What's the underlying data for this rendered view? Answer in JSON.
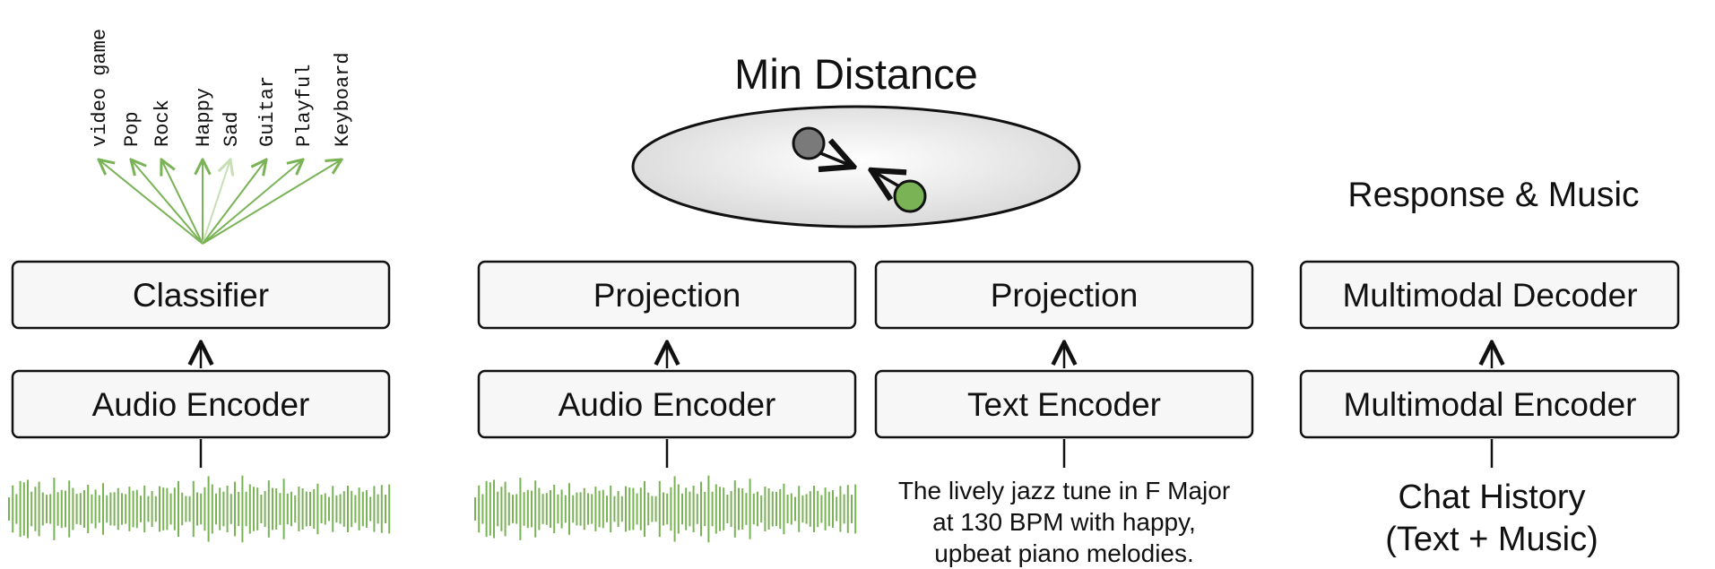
{
  "classification": {
    "labels": [
      "video game",
      "Pop",
      "Rock",
      "Happy",
      "Sad",
      "Guitar",
      "Playful",
      "Keyboard"
    ],
    "classifier_label": "Classifier",
    "encoder_label": "Audio Encoder"
  },
  "contrastive": {
    "title": "Min Distance",
    "audio_projection_label": "Projection",
    "text_projection_label": "Projection",
    "audio_encoder_label": "Audio Encoder",
    "text_encoder_label": "Text Encoder",
    "text_input_lines": [
      "The lively jazz tune in F Major",
      "at 130 BPM with happy,",
      "upbeat piano melodies."
    ]
  },
  "generation": {
    "output_label": "Response & Music",
    "decoder_label": "Multimodal Decoder",
    "encoder_label": "Multimodal Encoder",
    "input_lines": [
      "Chat History",
      "(Text + Music)"
    ]
  },
  "colors": {
    "green": "#79b356",
    "green_light": "#c7dfb5",
    "gray_dot": "#7a7a7a",
    "box_fill": "#f7f7f7",
    "stroke": "#111111"
  }
}
